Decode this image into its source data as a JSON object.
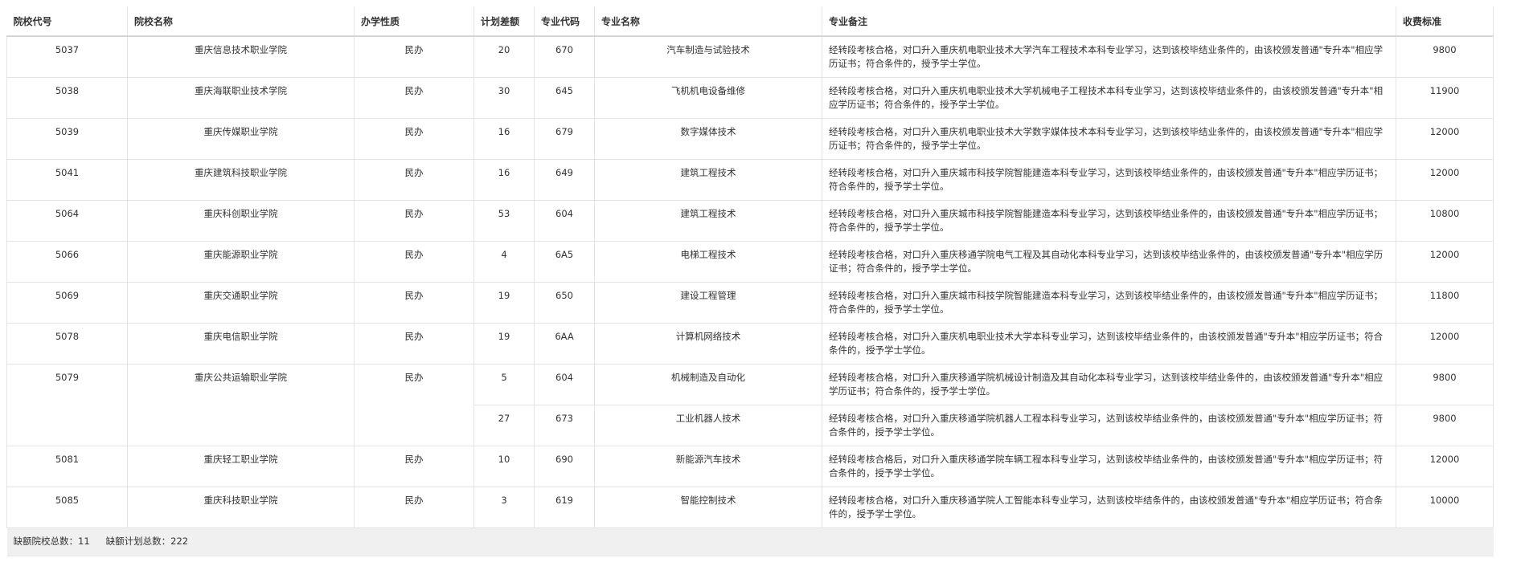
{
  "headers": [
    "院校代号",
    "院校名称",
    "办学性质",
    "计划差额",
    "专业代码",
    "专业名称",
    "专业备注",
    "收费标准"
  ],
  "rows": [
    {
      "code": "5037",
      "school": "重庆信息技术职业学院",
      "nature": "民办",
      "plan": "20",
      "major_code": "670",
      "major": "汽车制造与试验技术",
      "remark": "经转段考核合格，对口升入重庆机电职业技术大学汽车工程技术本科专业学习，达到该校毕结业条件的，由该校颁发普通\"专升本\"相应学历证书；符合条件的，授予学士学位。",
      "fee": "9800"
    },
    {
      "code": "5038",
      "school": "重庆海联职业技术学院",
      "nature": "民办",
      "plan": "30",
      "major_code": "645",
      "major": "飞机机电设备维修",
      "remark": "经转段考核合格，对口升入重庆机电职业技术大学机械电子工程技术本科专业学习，达到该校毕结业条件的，由该校颁发普通\"专升本\"相应学历证书；符合条件的，授予学士学位。",
      "fee": "11900"
    },
    {
      "code": "5039",
      "school": "重庆传媒职业学院",
      "nature": "民办",
      "plan": "16",
      "major_code": "679",
      "major": "数字媒体技术",
      "remark": "经转段考核合格，对口升入重庆机电职业技术大学数字媒体技术本科专业学习，达到该校毕结业条件的，由该校颁发普通\"专升本\"相应学历证书；符合条件的，授予学士学位。",
      "fee": "12000"
    },
    {
      "code": "5041",
      "school": "重庆建筑科技职业学院",
      "nature": "民办",
      "plan": "16",
      "major_code": "649",
      "major": "建筑工程技术",
      "remark": "经转段考核合格，对口升入重庆城市科技学院智能建造本科专业学习，达到该校毕结业条件的，由该校颁发普通\"专升本\"相应学历证书；符合条件的，授予学士学位。",
      "fee": "12000"
    },
    {
      "code": "5064",
      "school": "重庆科创职业学院",
      "nature": "民办",
      "plan": "53",
      "major_code": "604",
      "major": "建筑工程技术",
      "remark": "经转段考核合格，对口升入重庆城市科技学院智能建造本科专业学习，达到该校毕结业条件的，由该校颁发普通\"专升本\"相应学历证书；符合条件的，授予学士学位。",
      "fee": "10800"
    },
    {
      "code": "5066",
      "school": "重庆能源职业学院",
      "nature": "民办",
      "plan": "4",
      "major_code": "6A5",
      "major": "电梯工程技术",
      "remark": "经转段考核合格，对口升入重庆移通学院电气工程及其自动化本科专业学习，达到该校毕结业条件的，由该校颁发普通\"专升本\"相应学历证书；符合条件的，授予学士学位。",
      "fee": "12000"
    },
    {
      "code": "5069",
      "school": "重庆交通职业学院",
      "nature": "民办",
      "plan": "19",
      "major_code": "650",
      "major": "建设工程管理",
      "remark": "经转段考核合格，对口升入重庆城市科技学院智能建造本科专业学习，达到该校毕结业条件的，由该校颁发普通\"专升本\"相应学历证书；符合条件的，授予学士学位。",
      "fee": "11800"
    },
    {
      "code": "5078",
      "school": "重庆电信职业学院",
      "nature": "民办",
      "plan": "19",
      "major_code": "6AA",
      "major": "计算机网络技术",
      "remark": "经转段考核合格，对口升入重庆机电职业技术大学本科专业学习，达到该校毕结业条件的，由该校颁发普通\"专升本\"相应学历证书；符合条件的，授予学士学位。",
      "fee": "12000"
    },
    {
      "code": "5079",
      "school": "重庆公共运输职业学院",
      "nature": "民办",
      "plan": "5",
      "major_code": "604",
      "major": "机械制造及自动化",
      "remark": "经转段考核合格，对口升入重庆移通学院机械设计制造及其自动化本科专业学习，达到该校毕结业条件的，由该校颁发普通\"专升本\"相应学历证书；符合条件的，授予学士学位。",
      "fee": "9800"
    },
    {
      "code": "",
      "school": "",
      "nature": "",
      "plan": "27",
      "major_code": "673",
      "major": "工业机器人技术",
      "remark": "经转段考核合格，对口升入重庆移通学院机器人工程本科专业学习，达到该校毕结业条件的，由该校颁发普通\"专升本\"相应学历证书；符合条件的，授予学士学位。",
      "fee": "9800"
    },
    {
      "code": "5081",
      "school": "重庆轻工职业学院",
      "nature": "民办",
      "plan": "10",
      "major_code": "690",
      "major": "新能源汽车技术",
      "remark": "经转段考核合格后，对口升入重庆移通学院车辆工程本科专业学习，达到该校毕结业条件的，由该校颁发普通\"专升本\"相应学历证书；符合条件的，授予学士学位。",
      "fee": "12000"
    },
    {
      "code": "5085",
      "school": "重庆科技职业学院",
      "nature": "民办",
      "plan": "3",
      "major_code": "619",
      "major": "智能控制技术",
      "remark": "经转段考核合格，对口升入重庆移通学院人工智能本科专业学习，达到该校毕结条件的，由该校颁发普通\"专升本\"相应学历证书；符合条件的，授予学士学位。",
      "fee": "10000"
    }
  ],
  "footer": {
    "schools_label": "缺额院校总数：",
    "schools_count": "11",
    "plan_label": "缺额计划总数：",
    "plan_count": "222"
  }
}
